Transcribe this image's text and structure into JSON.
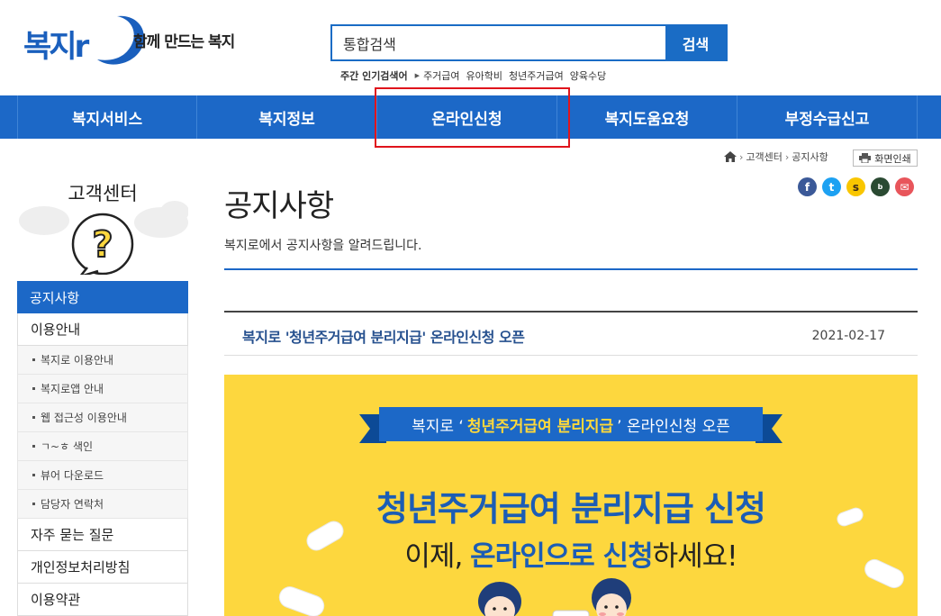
{
  "header": {
    "logo_text": "복지r",
    "tagline": "함께 만드는 복지",
    "search": {
      "value": "통합검색",
      "button_label": "검색"
    },
    "popular": {
      "label": "주간 인기검색어",
      "items": [
        "주거급여",
        "유아학비",
        "청년주거급여",
        "양육수당"
      ]
    }
  },
  "gnb": {
    "items": [
      "복지서비스",
      "복지정보",
      "온라인신청",
      "복지도움요청",
      "부정수급신고"
    ]
  },
  "sidebar": {
    "title": "고객센터",
    "active": "공지사항",
    "item_usage": "이용안내",
    "sub_items": [
      "복지로 이용안내",
      "복지로앱 안내",
      "웹 접근성 이용안내",
      "ㄱ~ㅎ 색인",
      "뷰어 다운로드",
      "담당자 연락처"
    ],
    "items_bottom": [
      "자주 묻는 질문",
      "개인정보처리방침",
      "이용약관"
    ]
  },
  "breadcrumb": {
    "home_icon": "home-icon",
    "items": [
      "고객센터",
      "공지사항"
    ],
    "print_label": "화면인쇄"
  },
  "share": [
    "facebook",
    "twitter",
    "kakaostory",
    "band",
    "email"
  ],
  "page": {
    "title": "공지사항",
    "description": "복지로에서 공지사항을 알려드립니다."
  },
  "post": {
    "title": "복지로 '청년주거급여 분리지급' 온라인신청 오픈",
    "date": "2021-02-17"
  },
  "banner": {
    "ribbon_prefix": "복지로 ‘",
    "ribbon_em": "청년주거급여 분리지급",
    "ribbon_suffix": "’ 온라인신청 오픈",
    "headline": "청년주거급여 분리지급 신청",
    "sub_part1": "이제, ",
    "sub_highlight1": "온라인으로 신청",
    "sub_part2": "하세요!"
  },
  "colors": {
    "brand_blue": "#1c68c7",
    "highlight_red": "#e0141c",
    "banner_yellow": "#fdd73e"
  }
}
